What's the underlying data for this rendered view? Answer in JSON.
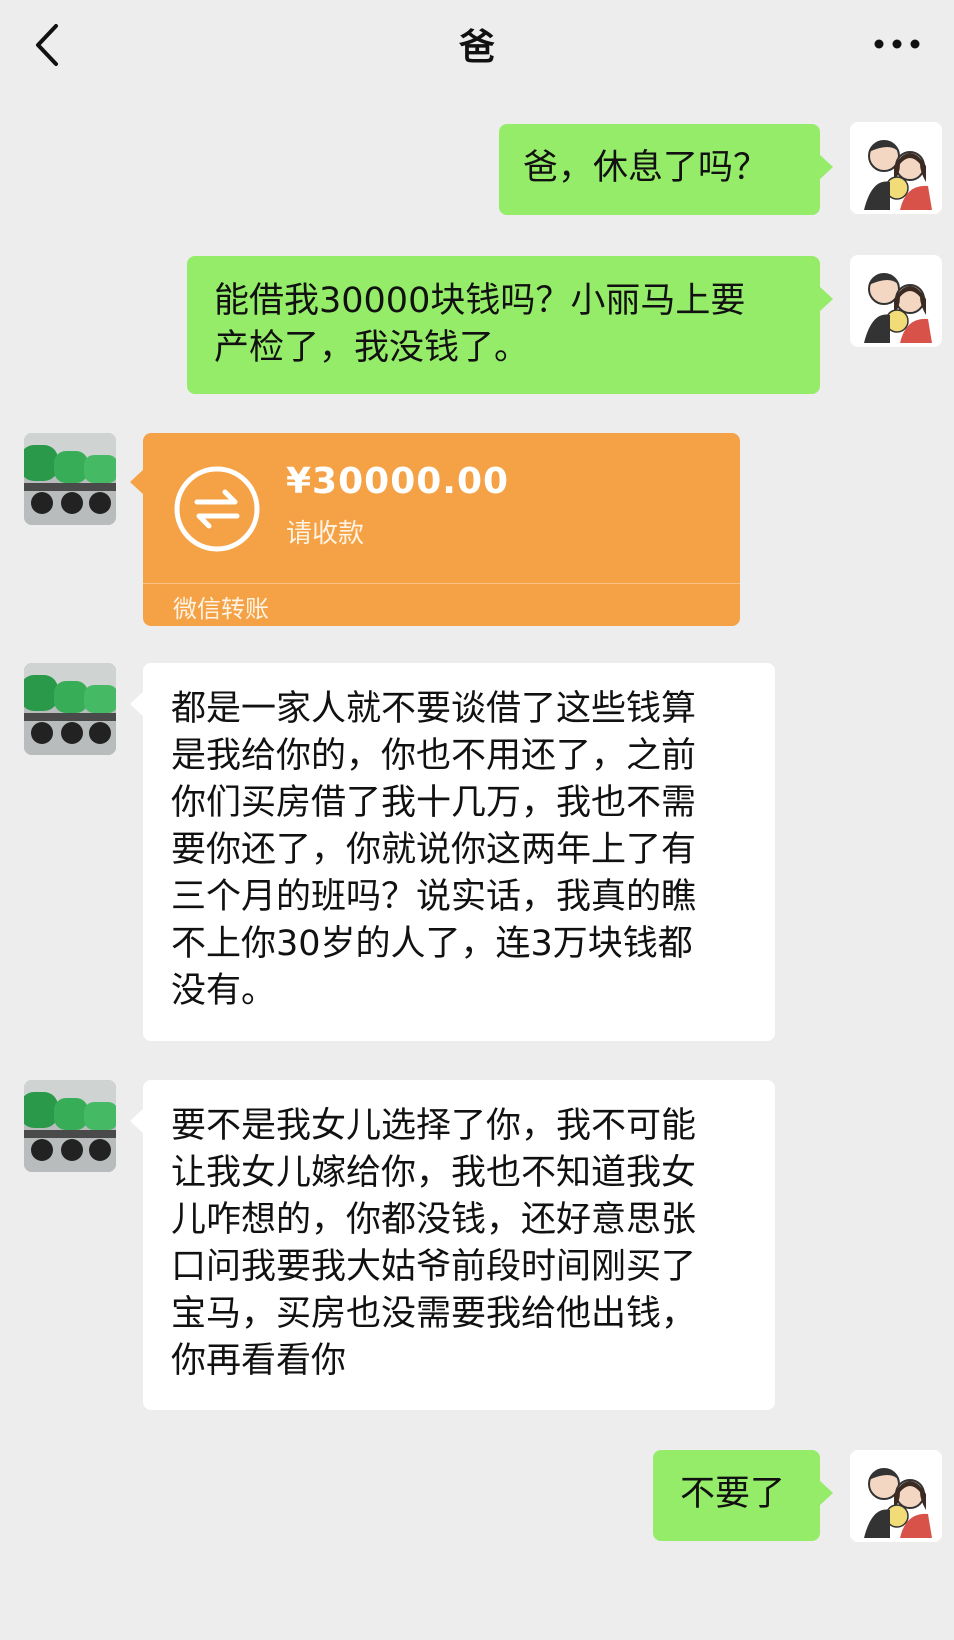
{
  "header": {
    "title": "爸"
  },
  "messages": {
    "m1": {
      "lines": [
        "爸，休息了吗？"
      ]
    },
    "m2": {
      "lines": [
        "能借我30000块钱吗？小丽马上要",
        "产检了，我没钱了。"
      ]
    },
    "transfer": {
      "amount": "¥30000.00",
      "status": "请收款",
      "label": "微信转账"
    },
    "m4": {
      "lines": [
        "都是一家人就不要谈借了这些钱算",
        "是我给你的，你也不用还了，之前",
        "你们买房借了我十几万，我也不需",
        "要你还了，你就说你这两年上了有",
        "三个月的班吗？说实话，我真的瞧",
        "不上你30岁的人了，连3万块钱都",
        "没有。"
      ]
    },
    "m5": {
      "lines": [
        "要不是我女儿选择了你，我不可能",
        "让我女儿嫁给你，我也不知道我女",
        "儿咋想的，你都没钱，还好意思张",
        "口问我要我大姑爷前段时间刚买了",
        "宝马，买房也没需要我给他出钱，",
        "你再看看你"
      ]
    },
    "m6": {
      "lines": [
        "不要了"
      ]
    }
  },
  "icons": {
    "back": "chevron-left-icon",
    "more": "more-dots-icon",
    "transfer": "transfer-arrows-icon"
  },
  "colors": {
    "background": "#ededed",
    "my_bubble": "#95ec69",
    "their_bubble": "#ffffff",
    "transfer_card": "#f5a246"
  }
}
